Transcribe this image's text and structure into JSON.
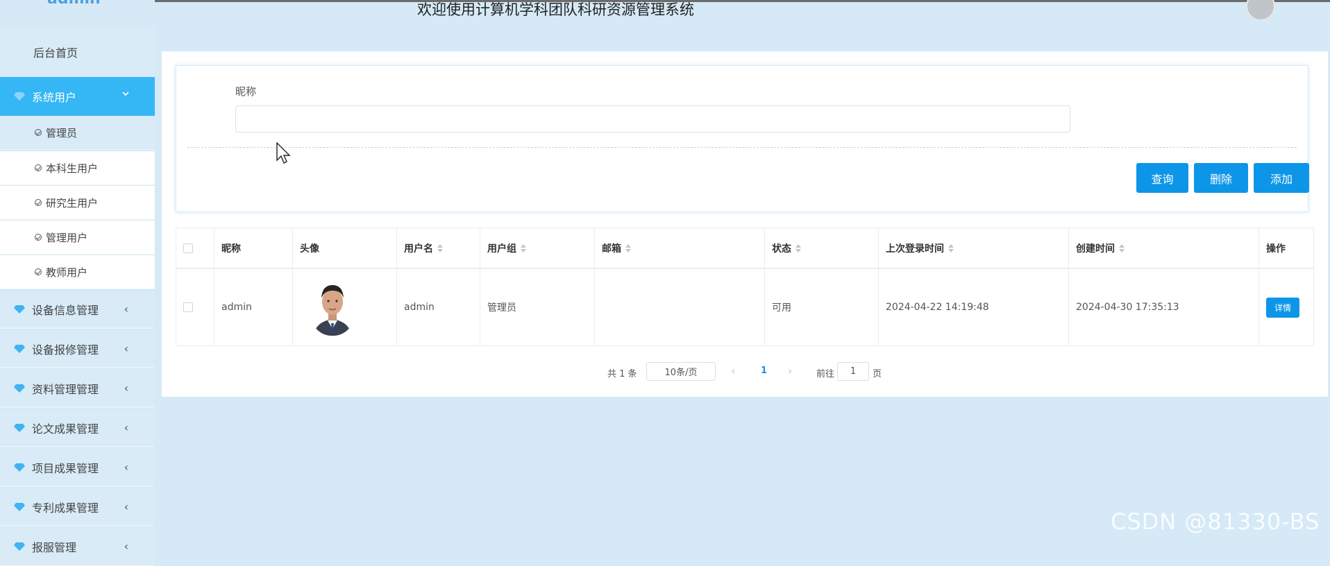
{
  "header": {
    "title": "欢迎使用计算机学科团队科研资源管理系统"
  },
  "sidebar": {
    "logo_text": "admin",
    "home": "后台首页",
    "active_group": "系统用户",
    "sub_items": [
      "管理员",
      "本科生用户",
      "研究生用户",
      "管理用户",
      "教师用户"
    ],
    "groups": [
      "设备信息管理",
      "设备报修管理",
      "资料管理管理",
      "论文成果管理",
      "项目成果管理",
      "专利成果管理",
      "报服管理"
    ]
  },
  "search": {
    "label": "昵称",
    "value": "",
    "buttons": {
      "query": "查询",
      "delete": "删除",
      "add": "添加"
    }
  },
  "table": {
    "headers": [
      "昵称",
      "头像",
      "用户名",
      "用户组",
      "邮箱",
      "状态",
      "上次登录时间",
      "创建时间",
      "操作"
    ],
    "rows": [
      {
        "nickname": "admin",
        "username": "admin",
        "group": "管理员",
        "email": "",
        "status": "可用",
        "last_login": "2024-04-22 14:19:48",
        "created": "2024-04-30 17:35:13",
        "action": "详情"
      }
    ]
  },
  "pagination": {
    "total": "共 1 条",
    "page_size": "10条/页",
    "current_page": "1",
    "goto_label": "前往",
    "goto_value": "1",
    "page_suffix": "页"
  },
  "watermark": "CSDN @81330-BS",
  "colors": {
    "accent": "#0d96e8",
    "sidebar_active": "#35b6f5",
    "background": "#d5e9f6"
  }
}
